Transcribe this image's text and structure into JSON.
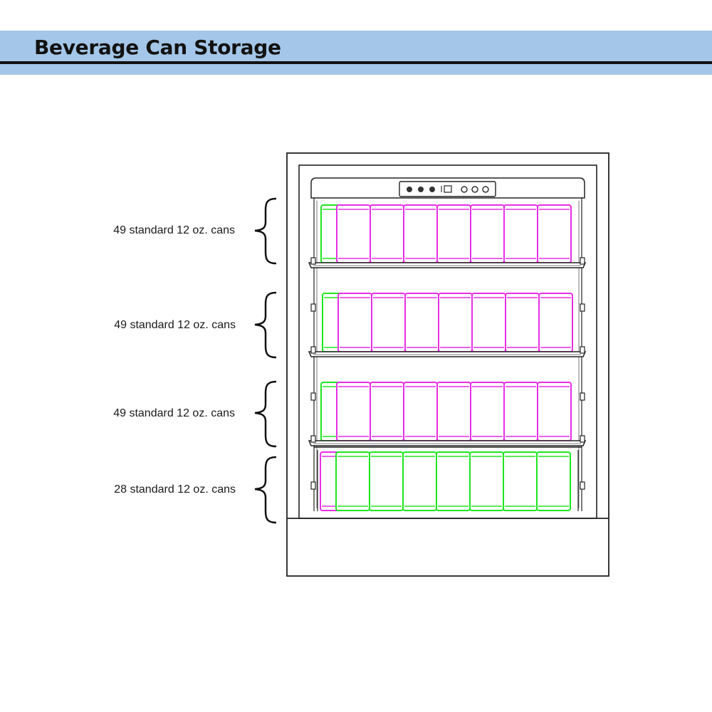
{
  "header": {
    "title": "Beverage Can Storage",
    "band_color": "#a4c6e8"
  },
  "shelves": [
    {
      "label": "49 standard 12 oz. cans",
      "pattern": "green-first"
    },
    {
      "label": "49 standard 12 oz. cans",
      "pattern": "green-first"
    },
    {
      "label": "49 standard 12 oz. cans",
      "pattern": "green-first"
    },
    {
      "label": "28 standard 12 oz. cans",
      "pattern": "magenta-first"
    }
  ],
  "can_colors": {
    "magenta": "#e62ee6",
    "green": "#1ee61e"
  },
  "control_panel_icons": [
    "button-icon",
    "button-icon",
    "button-icon",
    "display-icon",
    "button-icon",
    "button-icon",
    "button-icon"
  ]
}
